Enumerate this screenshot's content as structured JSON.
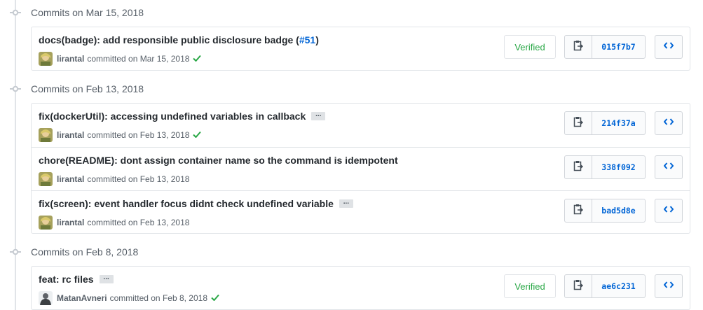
{
  "groups": [
    {
      "date_label": "Commits on Mar 15, 2018",
      "commits": [
        {
          "message": "docs(badge): add responsible public disclosure badge (",
          "issue": "#51",
          "message_end": ")",
          "author": "lirantal",
          "committed_text": "committed on Mar 15, 2018",
          "verified_label": "Verified",
          "sha": "015f7b7"
        }
      ]
    },
    {
      "date_label": "Commits on Feb 13, 2018",
      "commits": [
        {
          "message": "fix(dockerUtil): accessing undefined variables in callback",
          "author": "lirantal",
          "committed_text": "committed on Feb 13, 2018",
          "sha": "214f37a"
        },
        {
          "message": "chore(README): dont assign container name so the command is idempotent",
          "author": "lirantal",
          "committed_text": "committed on Feb 13, 2018",
          "sha": "338f092"
        },
        {
          "message": "fix(screen): event handler focus didnt check undefined variable",
          "author": "lirantal",
          "committed_text": "committed on Feb 13, 2018",
          "sha": "bad5d8e"
        }
      ]
    },
    {
      "date_label": "Commits on Feb 8, 2018",
      "commits": [
        {
          "message": "feat: rc files",
          "author": "MatanAvneri",
          "committed_text": "committed on Feb 8, 2018",
          "verified_label": "Verified",
          "sha": "ae6c231"
        }
      ]
    }
  ],
  "icons": {
    "timeline_node": "git-commit-icon",
    "copy": "clippy-icon",
    "browse": "code-icon",
    "status": "check-icon",
    "more": "ellipsis-icon"
  },
  "colors": {
    "link": "#0366d6",
    "verified": "#28a745",
    "check": "#28a745",
    "border": "#e1e4e8",
    "muted": "#586069"
  }
}
